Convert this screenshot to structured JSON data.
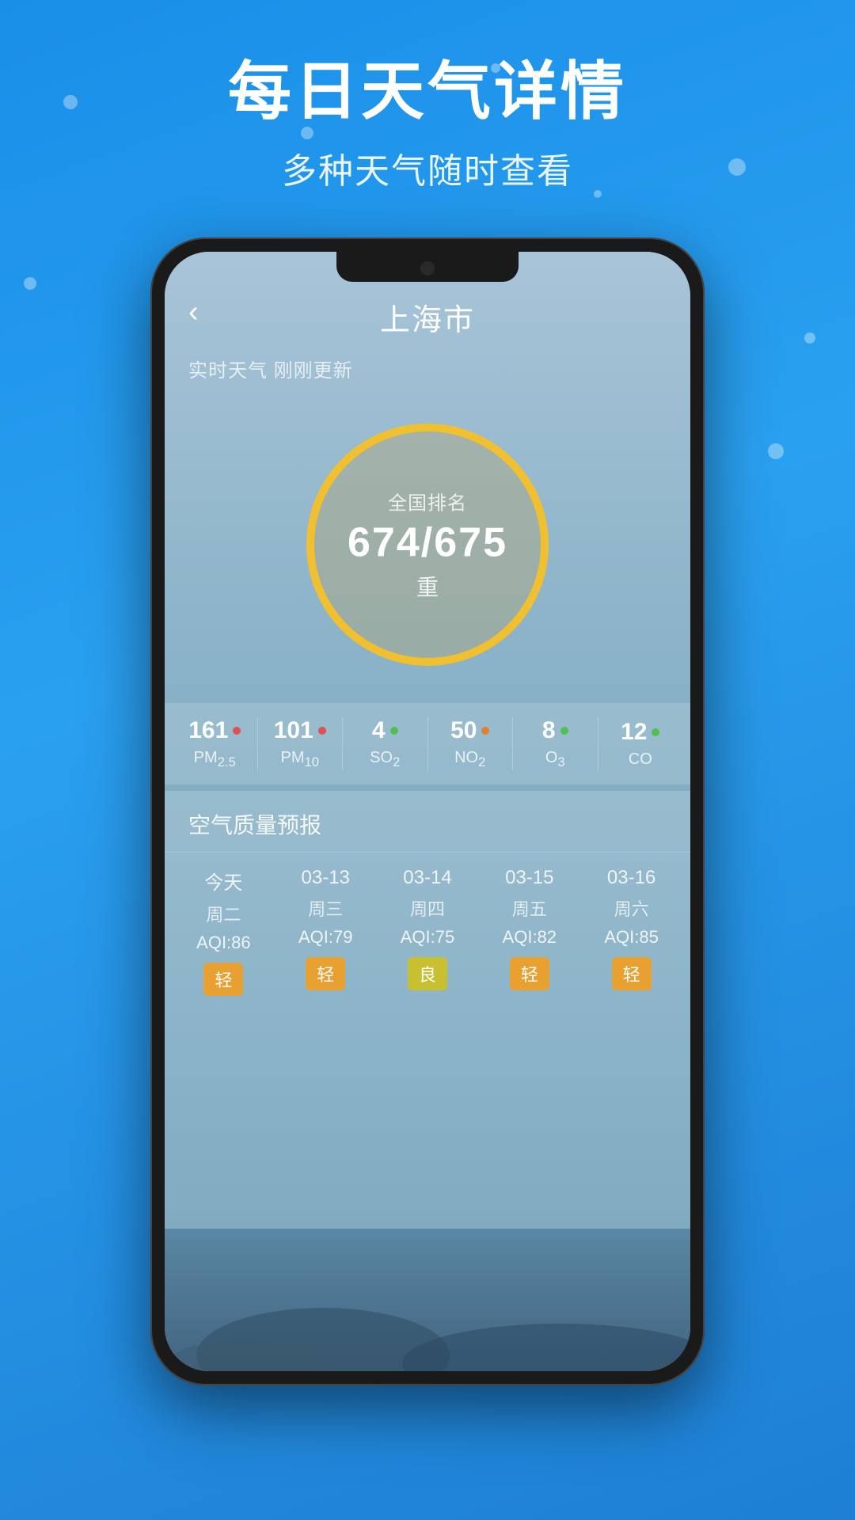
{
  "background": {
    "gradient_start": "#1a8fe8",
    "gradient_end": "#1e7fd4"
  },
  "header": {
    "main_title": "每日天气详情",
    "sub_title": "多种天气随时查看"
  },
  "app": {
    "back_label": "‹",
    "city_name": "上海市",
    "update_info": "实时天气 刚刚更新",
    "aqi_circle": {
      "label": "全国排名",
      "value": "674/675",
      "status": "重"
    },
    "pollutants": [
      {
        "value": "161",
        "dot_class": "dot-red",
        "label": "PM₂.₅"
      },
      {
        "value": "101",
        "dot_class": "dot-red",
        "label": "PM₁₀"
      },
      {
        "value": "4",
        "dot_class": "dot-green",
        "label": "SO₂"
      },
      {
        "value": "50",
        "dot_class": "dot-orange",
        "label": "NO₂"
      },
      {
        "value": "8",
        "dot_class": "dot-green",
        "label": "O₃"
      },
      {
        "value": "12",
        "dot_class": "dot-green",
        "label": "CO"
      }
    ],
    "forecast_section": {
      "title": "空气质量预报",
      "columns": [
        {
          "date": "今天",
          "weekday": "周二",
          "aqi": "AQI:86",
          "badge": "轻",
          "badge_class": "badge-light"
        },
        {
          "date": "03-13",
          "weekday": "周三",
          "aqi": "AQI:79",
          "badge": "轻",
          "badge_class": "badge-light"
        },
        {
          "date": "03-14",
          "weekday": "周四",
          "aqi": "AQI:75",
          "badge": "良",
          "badge_class": "badge-good"
        },
        {
          "date": "03-15",
          "weekday": "周五",
          "aqi": "AQI:82",
          "badge": "轻",
          "badge_class": "badge-light"
        },
        {
          "date": "03-16",
          "weekday": "周六",
          "aqi": "AQI:85",
          "badge": "轻",
          "badge_class": "badge-light"
        }
      ]
    }
  }
}
